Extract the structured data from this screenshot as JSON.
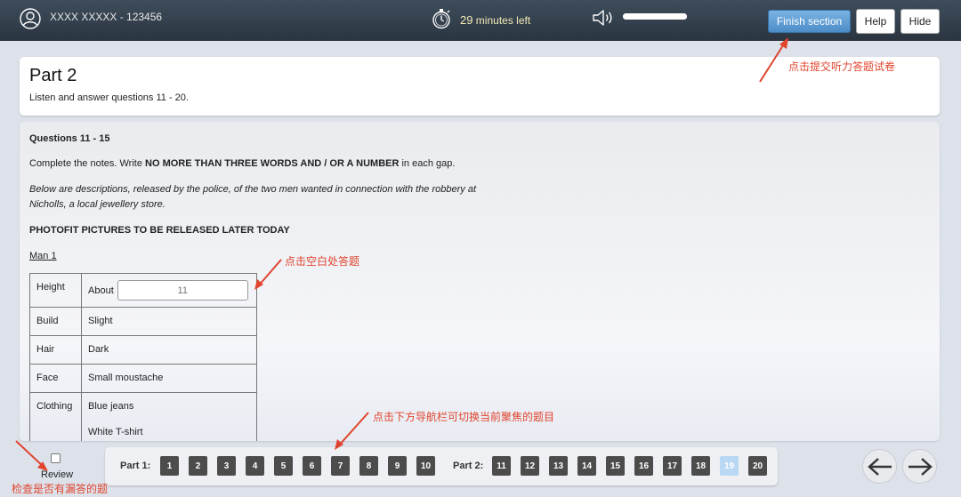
{
  "topbar": {
    "user_id": "XXXX XXXXX - 123456",
    "timer_value": "29",
    "timer_suffix": " minutes left",
    "volume_level": 1.0,
    "finish_label": "Finish section",
    "help_label": "Help",
    "hide_label": "Hide"
  },
  "part": {
    "title": "Part 2",
    "instruction": "Listen and answer questions 11 - 20."
  },
  "content": {
    "question_range": "Questions 11 - 15",
    "instruction_pre": "Complete the notes. Write ",
    "instruction_bold": "NO MORE THAN THREE WORDS AND / OR A NUMBER",
    "instruction_post": " in each gap.",
    "description": "Below are descriptions, released by the police, of the two men wanted in connection with the robbery at Nicholls, a local jewellery store.",
    "heading": "PHOTOFIT PICTURES TO BE RELEASED LATER TODAY",
    "subheading": "Man 1",
    "table": [
      {
        "label": "Height",
        "prefix": "About",
        "gap_placeholder": "11"
      },
      {
        "label": "Build",
        "value": "Slight"
      },
      {
        "label": "Hair",
        "value": "Dark"
      },
      {
        "label": "Face",
        "value": "Small moustache"
      },
      {
        "label": "Clothing",
        "values": [
          "Blue jeans",
          "White T-shirt"
        ]
      }
    ]
  },
  "review": {
    "label": "Review",
    "checked": false
  },
  "navigation": {
    "part1_label": "Part 1:",
    "part2_label": "Part 2:",
    "part1_questions": [
      "1",
      "2",
      "3",
      "4",
      "5",
      "6",
      "7",
      "8",
      "9",
      "10"
    ],
    "part2_questions": [
      "11",
      "12",
      "13",
      "14",
      "15",
      "16",
      "17",
      "18",
      "19",
      "20"
    ],
    "current_question": "19"
  },
  "annotations": {
    "finish": "点击提交听力答题试卷",
    "gap": "点击空白处答题",
    "nav": "点击下方导航栏可切换当前聚焦的题目",
    "review": "检查是否有漏答的题"
  },
  "colors": {
    "topbar": "#2f3b47",
    "finish_button": "#5b9bd5",
    "question_button": "#4c4c4c",
    "current_question": "#b9d8f3",
    "annotation": "#e0442d"
  }
}
